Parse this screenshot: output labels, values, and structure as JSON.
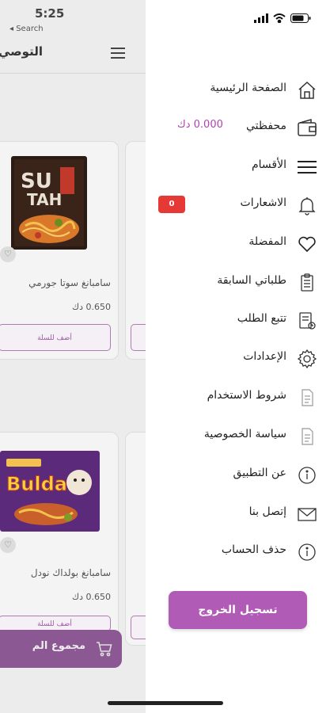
{
  "status_bar": {
    "time": "5:25",
    "back_label": "◂ Search"
  },
  "background": {
    "title": "التوصي",
    "products": [
      {
        "name": "سامبانغ سوتا جورمي",
        "price": "0.650 دك",
        "add_label": "أضف للسلة"
      },
      {
        "name": "سامبانغ بولداك نودل",
        "price": "0.650 دك",
        "add_label": "أضف للسلة"
      }
    ],
    "cart_label": "مجموع الم"
  },
  "drawer": {
    "menu": [
      {
        "label": "الصفحة الرئيسية",
        "icon": "home-icon"
      },
      {
        "label": "محفظتي",
        "icon": "wallet-icon"
      },
      {
        "label": "الأقسام",
        "icon": "menu-icon"
      },
      {
        "label": "الاشعارات",
        "icon": "bell-icon"
      },
      {
        "label": "المفضلة",
        "icon": "heart-icon"
      },
      {
        "label": "طلباتي السابقة",
        "icon": "clipboard-icon"
      },
      {
        "label": "تتبع الطلب",
        "icon": "track-icon"
      },
      {
        "label": "الإعدادات",
        "icon": "gear-icon"
      },
      {
        "label": "شروط الاستخدام",
        "icon": "document-icon"
      },
      {
        "label": "سياسة الخصوصية",
        "icon": "document-icon"
      },
      {
        "label": "عن التطبيق",
        "icon": "info-icon"
      },
      {
        "label": "إتصل بنا",
        "icon": "mail-icon"
      },
      {
        "label": "حذف الحساب",
        "icon": "info-icon"
      }
    ],
    "wallet_value": "0.000 دك",
    "notifications_count": "0",
    "logout_label": "تسجيل الخروج"
  },
  "colors": {
    "accent": "#b05cb6",
    "badge": "#e53935",
    "wallet_value": "#b042b0"
  }
}
